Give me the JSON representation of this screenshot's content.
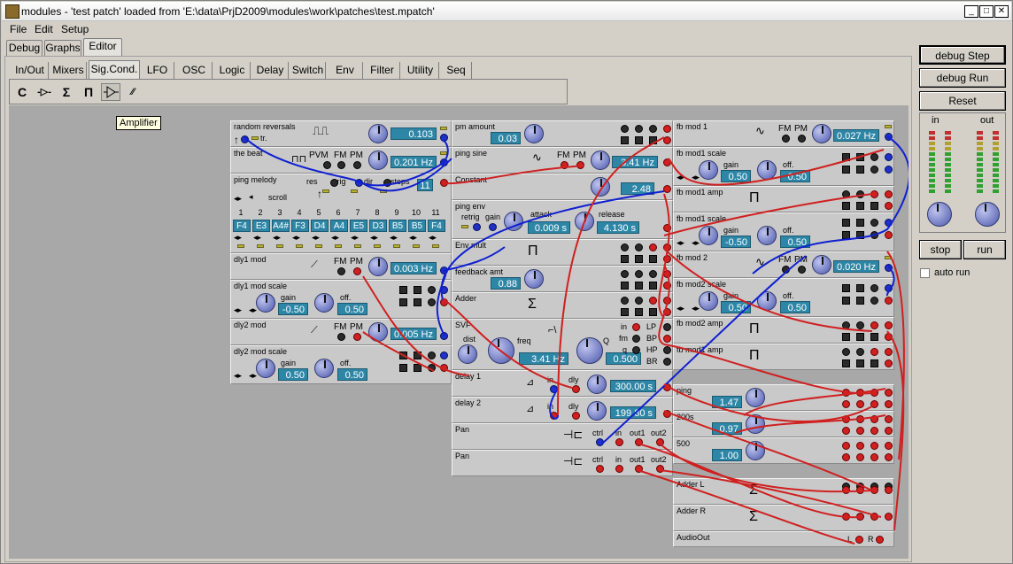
{
  "window": {
    "title": "modules - 'test patch' loaded from 'E:\\data\\PrjD2009\\modules\\work\\patches\\test.mpatch'",
    "min": "_",
    "max": "□",
    "close": "✕"
  },
  "menu": [
    "File",
    "Edit",
    "Setup"
  ],
  "main_tabs": [
    "Debug",
    "Graphs",
    "Editor"
  ],
  "sub_tabs": [
    "In/Out",
    "Mixers",
    "Sig.Cond.",
    "LFO",
    "OSC",
    "Logic",
    "Delay",
    "Switch",
    "Env",
    "Filter",
    "Utility",
    "Seq"
  ],
  "tools": [
    "C",
    "-▷-",
    "Σ",
    "Π",
    "amp",
    "⁄⁄"
  ],
  "tooltip": "Amplifier",
  "right": {
    "debug_step": "debug Step",
    "debug_run": "debug Run",
    "reset": "Reset",
    "in": "in",
    "out": "out",
    "stop": "stop",
    "run": "run",
    "auto_run": "auto run"
  },
  "modules": {
    "random_reversals": {
      "title": "random reversals",
      "tr": "tr.",
      "value": "0.103"
    },
    "the_beat": {
      "title": "the beat",
      "pvm": "PVM",
      "fm": "FM",
      "pm": "PM",
      "value": "0.201 Hz"
    },
    "ping_melody": {
      "title": "ping melody",
      "res": "res",
      "trig": "trig",
      "dir": "dir",
      "steps": "steps",
      "steps_val": "11",
      "scroll": "scroll",
      "nums": [
        "1",
        "2",
        "3",
        "4",
        "5",
        "6",
        "7",
        "8",
        "9",
        "10",
        "11"
      ],
      "notes": [
        "F4",
        "E3",
        "A4#",
        "F3",
        "D4",
        "A4",
        "E5",
        "D3",
        "B5",
        "B5",
        "F4"
      ]
    },
    "dly1_mod": {
      "title": "dly1 mod",
      "fm": "FM",
      "pm": "PM",
      "value": "0.003 Hz"
    },
    "dly1_mod_scale": {
      "title": "dly1 mod scale",
      "gain": "gain",
      "gain_val": "-0.50",
      "off": "off.",
      "off_val": "0.50"
    },
    "dly2_mod": {
      "title": "dly2 mod",
      "fm": "FM",
      "pm": "PM",
      "value": "0.005 Hz"
    },
    "dly2_mod_scale": {
      "title": "dly2 mod scale",
      "gain": "gain",
      "gain_val": "0.50",
      "off": "off.",
      "off_val": "0.50"
    },
    "pm_amount": {
      "title": "pm amount",
      "value": "0.03"
    },
    "ping_sine": {
      "title": "ping sine",
      "fm": "FM",
      "pm": "PM",
      "value": "3.41 Hz"
    },
    "constant": {
      "title": "Constant",
      "value": "2.48"
    },
    "ping_env": {
      "title": "ping env",
      "retrig": "retrig",
      "gain": "gain",
      "attack": "attack",
      "attack_val": "0.009 s",
      "release": "release",
      "release_val": "4.130 s"
    },
    "env_mult": {
      "title": "Env mult"
    },
    "feedback_amt": {
      "title": "feedback amt",
      "value": "0.88"
    },
    "adder": {
      "title": "Adder"
    },
    "svf": {
      "title": "SVF",
      "dist": "dist",
      "freq": "freq",
      "freq_val": "3.41 Hz",
      "q": "Q",
      "q_val": "0.500",
      "in": "in",
      "fm": "fm",
      "q2": "q",
      "lp": "LP",
      "bp": "BP",
      "hp": "HP",
      "br": "BR"
    },
    "delay1": {
      "title": "delay 1",
      "in": "in",
      "dly": "dly",
      "value": "300.00 s"
    },
    "delay2": {
      "title": "delay 2",
      "in": "in",
      "dly": "dly",
      "value": "199.80 s"
    },
    "pan1": {
      "title": "Pan",
      "ctrl": "ctrl",
      "in": "in",
      "out1": "out1",
      "out2": "out2"
    },
    "pan2": {
      "title": "Pan",
      "ctrl": "ctrl",
      "in": "in",
      "out1": "out1",
      "out2": "out2"
    },
    "fb_mod1": {
      "title": "fb mod 1",
      "fm": "FM",
      "pm": "PM",
      "value": "0.027 Hz"
    },
    "fb_mod1_scale": {
      "title": "fb mod1 scale",
      "gain": "gain",
      "gain_val": "0.50",
      "off": "off.",
      "off_val": "0.50"
    },
    "fb_mod1_amp": {
      "title": "fb mod1 amp"
    },
    "fb_mod1_scale_b": {
      "title": "fb mod1 scale",
      "gain": "gain",
      "gain_val": "-0.50",
      "off": "off.",
      "off_val": "0.50"
    },
    "fb_mod2": {
      "title": "fb mod 2",
      "fm": "FM",
      "pm": "PM",
      "value": "0.020 Hz"
    },
    "fb_mod2_scale": {
      "title": "fb mod2 scale",
      "gain": "gain",
      "gain_val": "0.50",
      "off": "off.",
      "off_val": "0.50"
    },
    "fb_mod2_amp": {
      "title": "fb mod2 amp"
    },
    "fb_mod1_amp_b": {
      "title": "fb mod1 amp"
    },
    "ping": {
      "title": "ping",
      "value": "1.47"
    },
    "m200s": {
      "title": "200s",
      "value": "0.97"
    },
    "m500": {
      "title": "500",
      "value": "1.00"
    },
    "adder_l": {
      "title": "Adder L"
    },
    "adder_r": {
      "title": "Adder R"
    },
    "audio_out": {
      "title": "AudioOut",
      "l": "L",
      "r": "R"
    }
  }
}
